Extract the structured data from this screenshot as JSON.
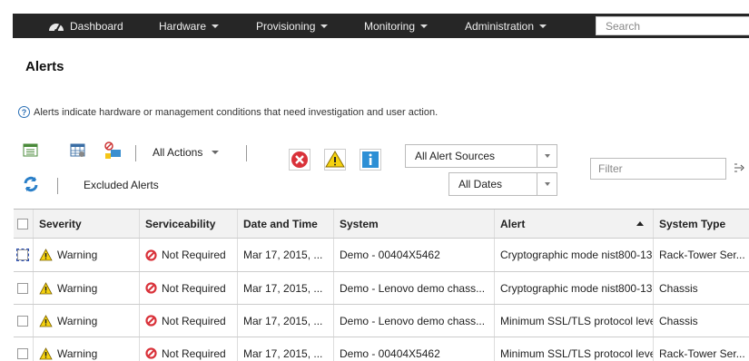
{
  "nav": {
    "dashboard": "Dashboard",
    "hardware": "Hardware",
    "provisioning": "Provisioning",
    "monitoring": "Monitoring",
    "administration": "Administration",
    "search_placeholder": "Search"
  },
  "page": {
    "title": "Alerts",
    "info": "Alerts indicate hardware or management conditions that need investigation and user action."
  },
  "toolbar": {
    "all_actions": "All Actions",
    "source_filter": "All Alert Sources",
    "date_filter": "All Dates",
    "filter_placeholder": "Filter",
    "excluded_alerts": "Excluded Alerts"
  },
  "table": {
    "headers": [
      "Severity",
      "Serviceability",
      "Date and Time",
      "System",
      "Alert",
      "System Type"
    ],
    "sorted_column": "Alert",
    "rows": [
      {
        "severity": "Warning",
        "serviceability": "Not Required",
        "date": "Mar 17, 2015, ...",
        "system": "Demo - 00404X5462",
        "alert": "Cryptographic mode nist800-13",
        "type": "Rack-Tower Ser..."
      },
      {
        "severity": "Warning",
        "serviceability": "Not Required",
        "date": "Mar 17, 2015, ...",
        "system": "Demo - Lenovo demo chass...",
        "alert": "Cryptographic mode nist800-13",
        "type": "Chassis"
      },
      {
        "severity": "Warning",
        "serviceability": "Not Required",
        "date": "Mar 17, 2015, ...",
        "system": "Demo - Lenovo demo chass...",
        "alert": "Minimum SSL/TLS protocol leve",
        "type": "Chassis"
      },
      {
        "severity": "Warning",
        "serviceability": "Not Required",
        "date": "Mar 17, 2015, ...",
        "system": "Demo - 00404X5462",
        "alert": "Minimum SSL/TLS protocol leve",
        "type": "Rack-Tower Ser..."
      }
    ]
  },
  "colors": {
    "nav_bg": "#262626",
    "link": "#1a66b0",
    "error_red": "#d9323a",
    "warning_yellow": "#f5d20f",
    "info_blue": "#2d8fd5"
  }
}
